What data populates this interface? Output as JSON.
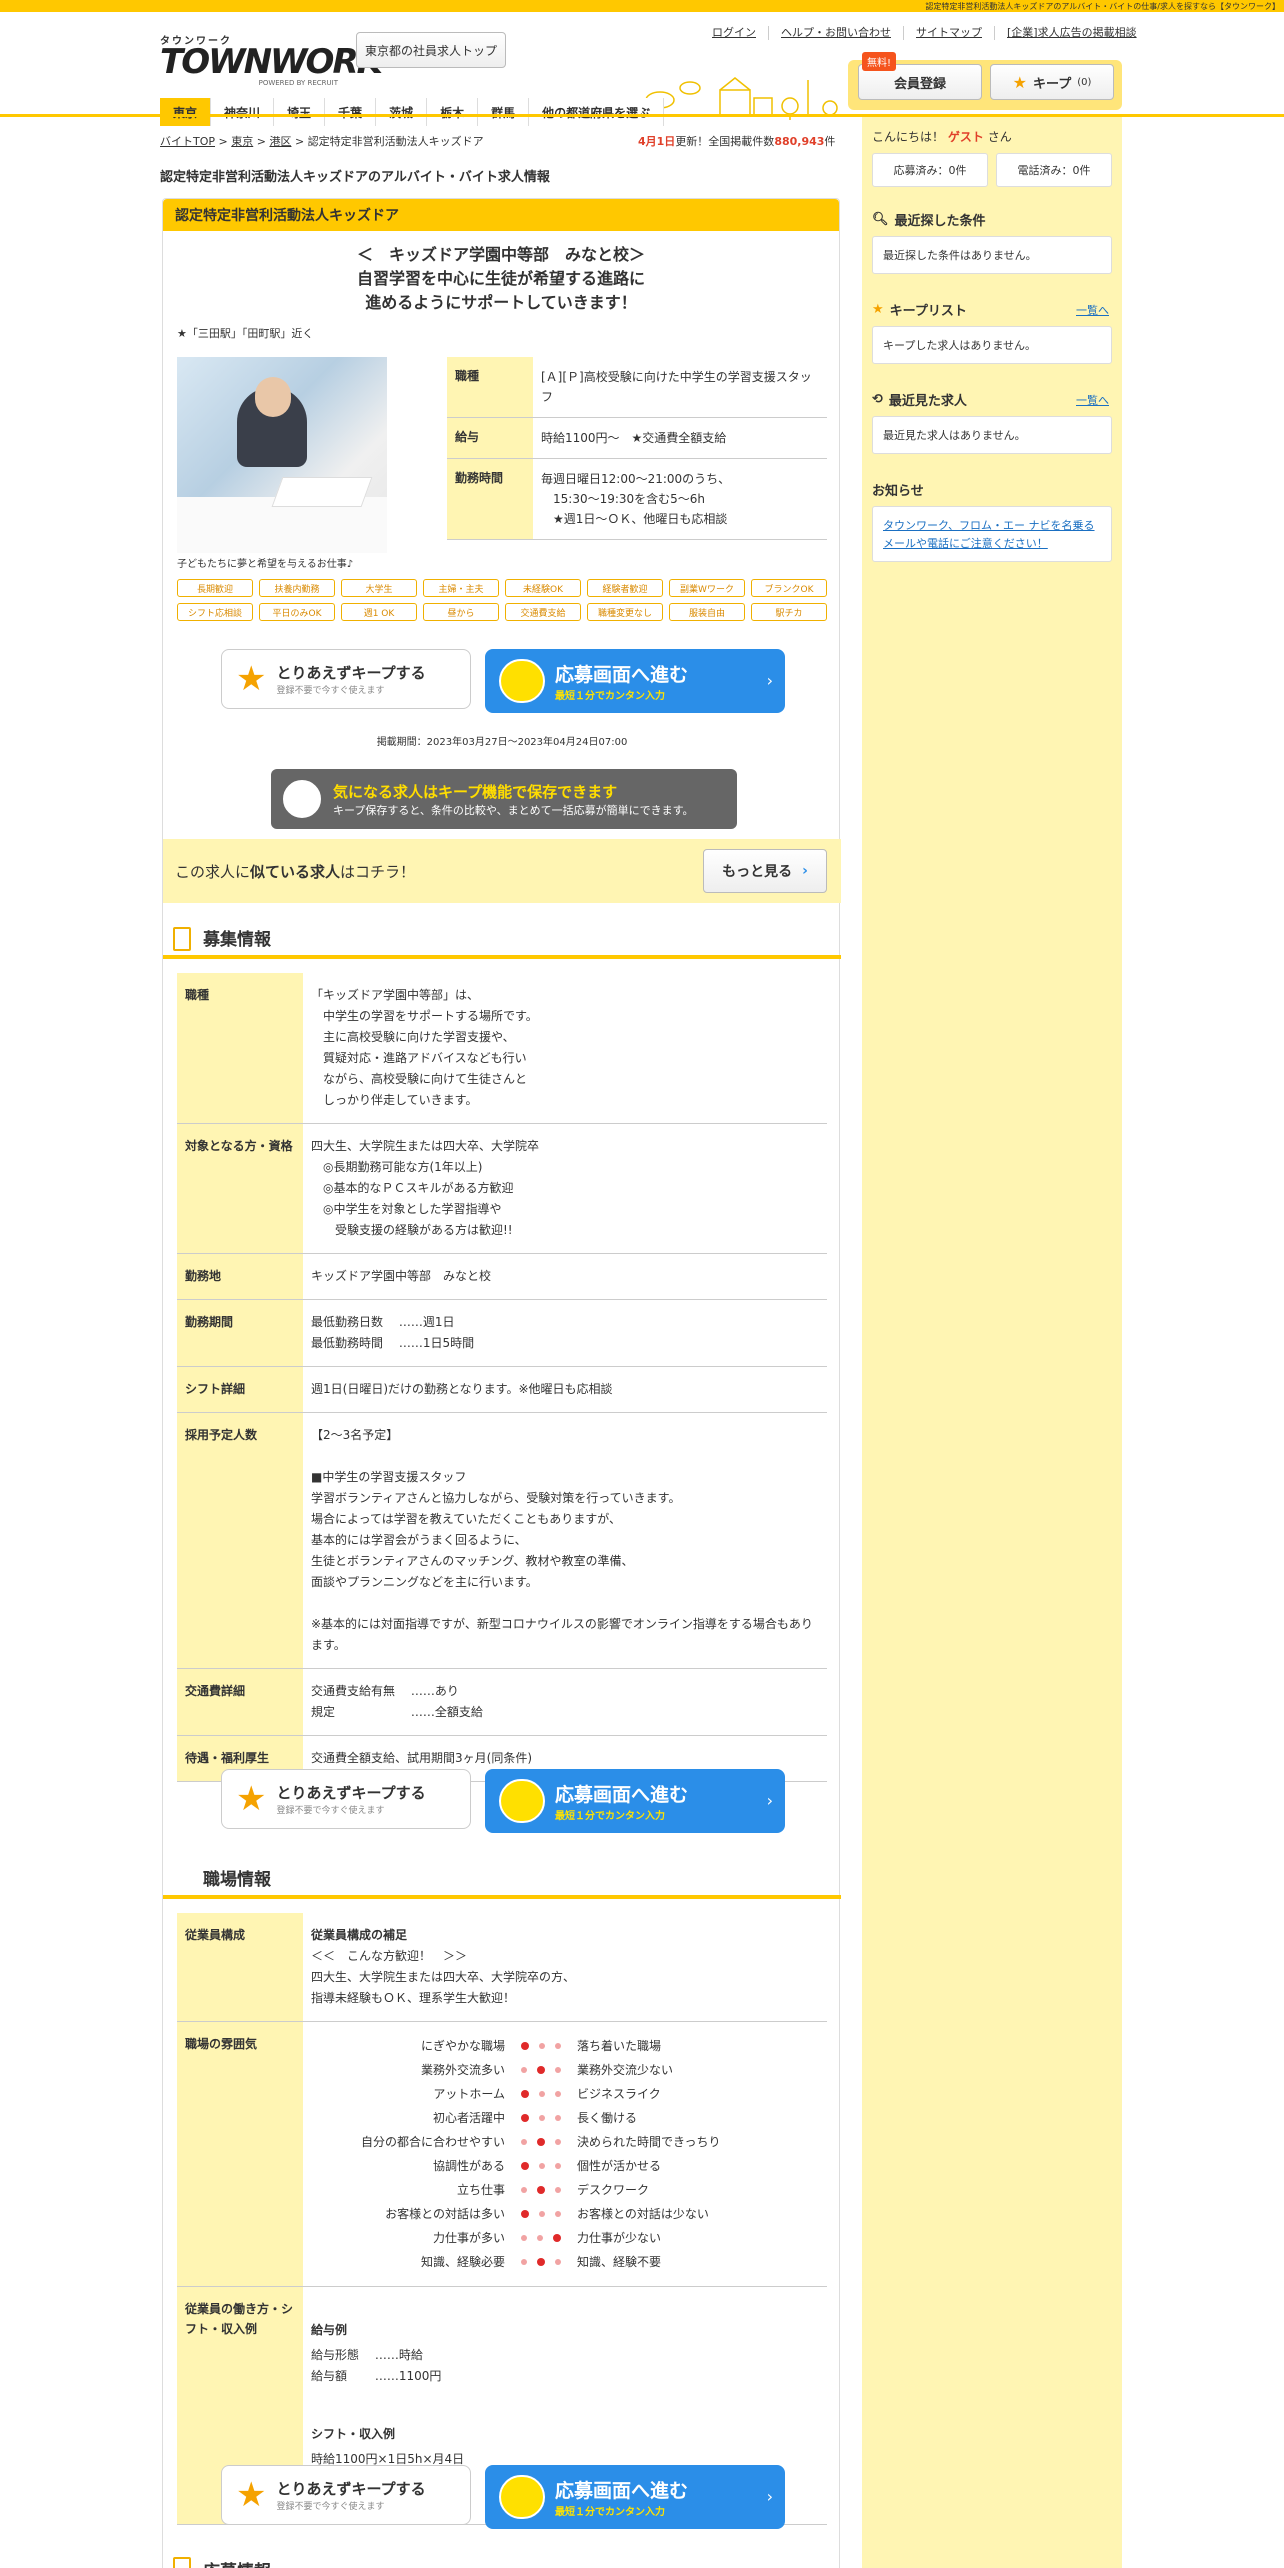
{
  "topbar": {
    "text": "認定特定非営利活動法人キッズドアのアルバイト・バイトの仕事/求人を探すなら【タウンワーク】"
  },
  "header": {
    "logo_small": "タウンワーク",
    "logo_main": "TOWNWORK",
    "logo_sub": "POWERED BY RECRUIT",
    "region_top": "東京都の社員求人トップ",
    "links": [
      "ログイン",
      "ヘルプ・お問い合わせ",
      "サイトマップ",
      "[企業]求人広告の掲載相談"
    ],
    "free_badge": "無料!",
    "member_btn": "会員登録",
    "keep_btn": "キープ",
    "keep_count": "(0)"
  },
  "nav": {
    "items": [
      "東京",
      "神奈川",
      "埼玉",
      "千葉",
      "茨城",
      "栃木",
      "群馬",
      "他の都道府県を選ぶ"
    ]
  },
  "breadcrumb": {
    "items": [
      "バイトTOP",
      "東京",
      "港区"
    ],
    "current": "認定特定非営利活動法人キッズドア",
    "sep": ">"
  },
  "updated": {
    "date": "4月1日",
    "text1": "更新！全国掲載件数",
    "count": "880,943",
    "unit": "件"
  },
  "page_title": "認定特定非営利活動法人キッズドアのアルバイト・バイト求人情報",
  "job": {
    "company": "認定特定非営利活動法人キッズドア",
    "catch1": "＜　キッズドア学園中等部　みなと校＞",
    "catch2": "自習学習を中心に生徒が希望する進路に",
    "catch3": "進めるようにサポートしていきます！",
    "station": "★「三田駅」「田町駅」近く",
    "photo_caption": "子どもたちに夢と希望を与えるお仕事♪",
    "info": [
      {
        "th": "職種",
        "td": "[Ａ][Ｐ]高校受験に向けた中学生の学習支援スタッフ"
      },
      {
        "th": "給与",
        "td": "時給1100円～　★交通費全額支給"
      },
      {
        "th": "勤務時間",
        "td": "毎週日曜日12:00～21:00のうち、\n　15:30～19:30を含む5～6h\n　★週1日～ＯＫ、他曜日も応相談"
      }
    ],
    "tags": [
      "長期歓迎",
      "扶養内勤務",
      "大学生",
      "主婦・主夫",
      "未経験OK",
      "経験者歓迎",
      "副業Wワーク",
      "ブランクOK",
      "シフト応相談",
      "平日のみOK",
      "週1 OK",
      "昼から",
      "交通費支給",
      "職種変更なし",
      "服装自由",
      "駅チカ"
    ],
    "period": "掲載期間：2023年03月27日～2023年04月24日07:00"
  },
  "buttons": {
    "keep_main": "とりあえずキープする",
    "keep_sub": "登録不要で今すぐ使えます",
    "apply_main": "応募画面へ進む",
    "apply_sub": "最短１分でカンタン入力"
  },
  "keep_banner": {
    "t1": "気になる求人はキープ機能で保存できます",
    "t2": "キープ保存すると、条件の比較や、まとめて一括応募が簡単にできます。"
  },
  "similar": {
    "pre": "この求人に",
    "strong": "似ている求人",
    "post": "はコチラ！",
    "more": "もっと見る"
  },
  "boshu": {
    "title": "募集情報",
    "rows": [
      {
        "th": "職種",
        "td": "「キッズドア学園中等部」は、\n　中学生の学習をサポートする場所です。\n　主に高校受験に向けた学習支援や、\n　質疑対応・進路アドバイスなども行い\n　ながら、高校受験に向けて生徒さんと\n　しっかり伴走していきます。"
      },
      {
        "th": "対象となる方・資格",
        "td": "四大生、大学院生または四大卒、大学院卒\n　◎長期勤務可能な方(1年以上)\n　◎基本的なＰＣスキルがある方歓迎\n　◎中学生を対象とした学習指導や\n　　受験支援の経験がある方は歓迎!!"
      },
      {
        "th": "勤務地",
        "td": "キッズドア学園中等部　みなと校"
      },
      {
        "th": "勤務期間",
        "td": "最低勤務日数　 ……週1日\n最低勤務時間　 ……1日5時間"
      },
      {
        "th": "シフト詳細",
        "td": "週1日(日曜日)だけの勤務となります。※他曜日も応相談"
      },
      {
        "th": "採用予定人数",
        "td": "【2～3名予定】\n\n■中学生の学習支援スタッフ\n学習ボランティアさんと協力しながら、受験対策を行っていきます。\n場合によっては学習を教えていただくこともありますが、\n基本的には学習会がうまく回るように、\n生徒とボランティアさんのマッチング、教材や教室の準備、\n面談やプランニングなどを主に行います。\n\n※基本的には対面指導ですが、新型コロナウイルスの影響でオンライン指導をする場合もあります。"
      },
      {
        "th": "交通費詳細",
        "td": "交通費支給有無　 ……あり\n規定　　　　　　 ……全額支給"
      },
      {
        "th": "待遇・福利厚生",
        "td": "交通費全額支給、試用期間3ヶ月(同条件)"
      }
    ]
  },
  "shokuba": {
    "title": "職場情報",
    "composition_th": "従業員構成",
    "composition_title": "従業員構成の補足",
    "composition_text": "＜＜　こんな方歓迎！　＞＞\n四大生、大学院生または四大卒、大学院卒の方、\n指導未経験もＯＫ、理系学生大歓迎！",
    "atmosphere_th": "職場の雰囲気",
    "atmosphere": [
      {
        "left": "にぎやかな職場",
        "right": "落ち着いた職場",
        "level": 1
      },
      {
        "left": "業務外交流多い",
        "right": "業務外交流少ない",
        "level": 2
      },
      {
        "left": "アットホーム",
        "right": "ビジネスライク",
        "level": 1
      },
      {
        "left": "初心者活躍中",
        "right": "長く働ける",
        "level": 1
      },
      {
        "left": "自分の都合に合わせやすい",
        "right": "決められた時間できっちり",
        "level": 2
      },
      {
        "left": "協調性がある",
        "right": "個性が活かせる",
        "level": 1
      },
      {
        "left": "立ち仕事",
        "right": "デスクワーク",
        "level": 2
      },
      {
        "left": "お客様との対話は多い",
        "right": "お客様との対話は少ない",
        "level": 1
      },
      {
        "left": "力仕事が多い",
        "right": "力仕事が少ない",
        "level": 3
      },
      {
        "left": "知識、経験必要",
        "right": "知識、経験不要",
        "level": 2
      }
    ],
    "work_th": "従業員の働き方・シフト・収入例",
    "pay_title": "給与例",
    "pay_text": "給与形態　 ……時給\n給与額　　 ……1100円",
    "shift_title": "シフト・収入例",
    "shift_text": "時給1100円×1日5h×月4日\n＝月収2万2000円"
  },
  "oubo": {
    "title": "応募情報"
  },
  "sidebar": {
    "greet_pre": "こんにちは！",
    "guest": "ゲスト",
    "greet_post": "さん",
    "applied": "応募済み：0件",
    "phoned": "電話済み：0件",
    "recent_search_title": "最近探した条件",
    "recent_search_empty": "最近探した条件はありません。",
    "keeplist_title": "キープリスト",
    "keeplist_link": "一覧へ",
    "keeplist_empty": "キープした求人はありません。",
    "recent_view_title": "最近見た求人",
    "recent_view_link": "一覧へ",
    "recent_view_empty": "最近見た求人はありません。",
    "notice_title": "お知らせ",
    "notice_text": "タウンワーク、フロム・エー ナビを名乗るメールや電話にご注意ください！"
  },
  "colors": {
    "brand": "#ffc800",
    "apply": "#2b8ee8",
    "accent_red": "#e0402a"
  }
}
